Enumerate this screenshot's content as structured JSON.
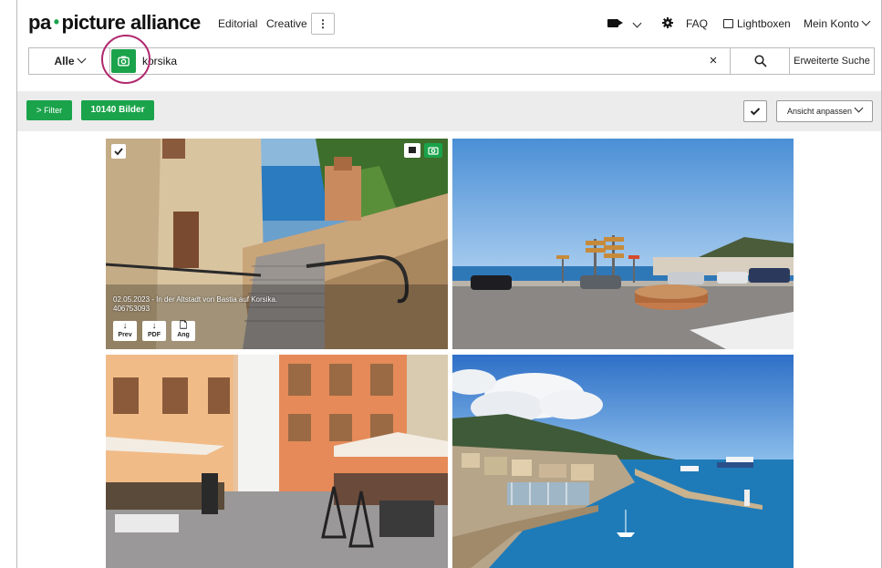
{
  "header": {
    "logo_left": "pa",
    "logo_dot": "•",
    "logo_right": "picture alliance",
    "nav": [
      "Editorial",
      "Creative"
    ],
    "more_label": "⋮",
    "faq": "FAQ",
    "lightbox": "Lightboxen",
    "account": "Mein Konto"
  },
  "search": {
    "category": "Alle",
    "query": "korsika",
    "clear": "×",
    "advanced": "Erweiterte Suche"
  },
  "toolbar": {
    "filter": "Filter",
    "result_count": "10140 Bilder",
    "view": "Ansicht anpassen"
  },
  "tiles": [
    {
      "caption_line1": "02.05.2023 - In der Altstadt von Bastia auf Korsika.",
      "caption_line2": "406753093",
      "actions": [
        "Prev",
        "PDF",
        "Ang"
      ]
    }
  ],
  "colors": {
    "brand_green": "#1aa34a",
    "highlight": "#b0286e",
    "toolbar_bg": "#ececec"
  }
}
